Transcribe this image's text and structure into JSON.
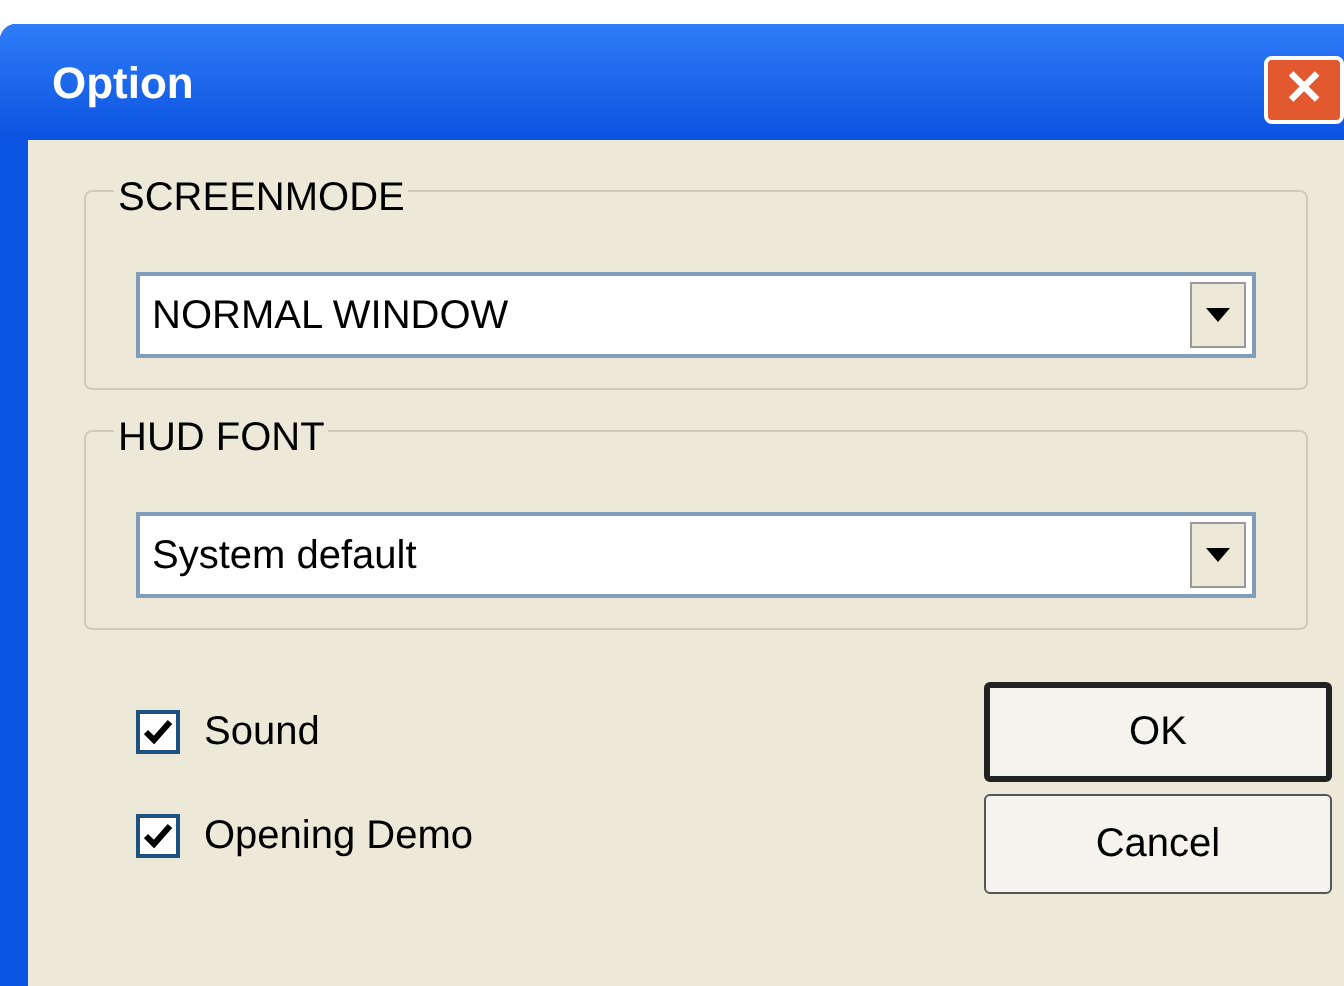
{
  "window": {
    "title": "Option",
    "close": "✕"
  },
  "groups": [
    {
      "label": "SCREENMODE",
      "value": "NORMAL WINDOW"
    },
    {
      "label": "HUD FONT",
      "value": "System default"
    }
  ],
  "checkboxes": [
    {
      "label": "Sound",
      "checked": true
    },
    {
      "label": "Opening Demo",
      "checked": true
    }
  ],
  "buttons": [
    {
      "label": "OK",
      "default": true
    },
    {
      "label": "Cancel",
      "default": false
    }
  ]
}
